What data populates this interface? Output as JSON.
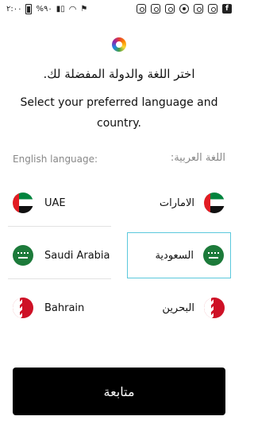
{
  "status_bar": {
    "time": "٢:٠٠",
    "battery_text": "%٩٠",
    "icons": [
      "battery-icon",
      "signal-icon",
      "wifi-icon",
      "flag-icon",
      "instagram-icon",
      "instagram-icon",
      "instagram-icon",
      "chrome-icon",
      "instagram-icon",
      "instagram-icon",
      "facebook-icon"
    ]
  },
  "header": {
    "logo": "rainbow-logo-icon",
    "title_ar": "اختر اللغة والدولة المفضلة لك.",
    "title_en": "Select your preferred language and country."
  },
  "columns": {
    "english_label": "English language:",
    "arabic_label": "اللغة العربية:"
  },
  "countries": [
    {
      "en": "UAE",
      "ar": "الامارات",
      "flag": "uae-flag-icon"
    },
    {
      "en": "Saudi Arabia",
      "ar": "السعودية",
      "flag": "saudi-flag-icon",
      "selected_side": "arabic"
    },
    {
      "en": "Bahrain",
      "ar": "البحرين",
      "flag": "bahrain-flag-icon"
    }
  ],
  "continue_button": "متابعة",
  "colors": {
    "selected_border": "#5bc8dc",
    "button_bg": "#000000",
    "muted_text": "#888888"
  }
}
